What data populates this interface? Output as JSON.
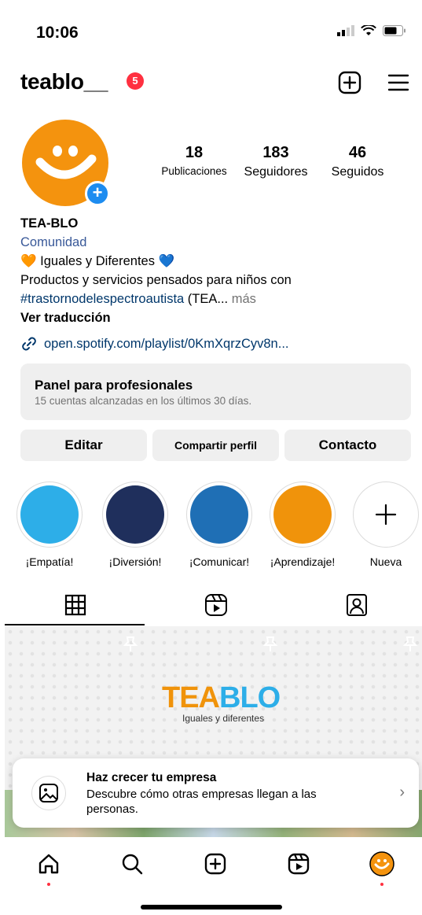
{
  "status_bar": {
    "time": "10:06"
  },
  "header": {
    "username": "teablo__",
    "notification_count": "5"
  },
  "profile": {
    "stats": [
      {
        "value": "18",
        "label": "Publicaciones"
      },
      {
        "value": "183",
        "label": "Seguidores"
      },
      {
        "value": "46",
        "label": "Seguidos"
      }
    ],
    "name": "TEA-BLO",
    "category": "Comunidad",
    "bio_line1": "🧡 Iguales y Diferentes 💙",
    "bio_line2": "Productos y servicios pensados para niños con",
    "bio_hashtag": "#trastornodelespectroautista",
    "bio_tail": " (TEA...",
    "bio_more": " más",
    "translate": "Ver traducción",
    "link": "open.spotify.com/playlist/0KmXqrzCyv8n..."
  },
  "panel": {
    "title": "Panel para profesionales",
    "subtitle": "15 cuentas alcanzadas en los últimos 30 días."
  },
  "buttons": {
    "edit": "Editar",
    "share": "Compartir perfil",
    "contact": "Contacto"
  },
  "highlights": [
    {
      "label": "¡Empatía!",
      "color": "#2daee8"
    },
    {
      "label": "¡Diversión!",
      "color": "#1f2f5c"
    },
    {
      "label": "¡Comunicar!",
      "color": "#1f6fb5"
    },
    {
      "label": "¡Aprendizaje!",
      "color": "#f0930b"
    },
    {
      "label": "Nueva",
      "color": "#ffffff"
    }
  ],
  "post": {
    "logo": "TEA BLO",
    "tagline": "Iguales y diferentes"
  },
  "promo": {
    "title": "Haz crecer tu empresa",
    "description": "Descubre cómo otras empresas llegan a las personas."
  },
  "colors": {
    "accent_orange": "#f4930e",
    "link_blue": "#00376b",
    "badge_red": "#ff3040"
  }
}
